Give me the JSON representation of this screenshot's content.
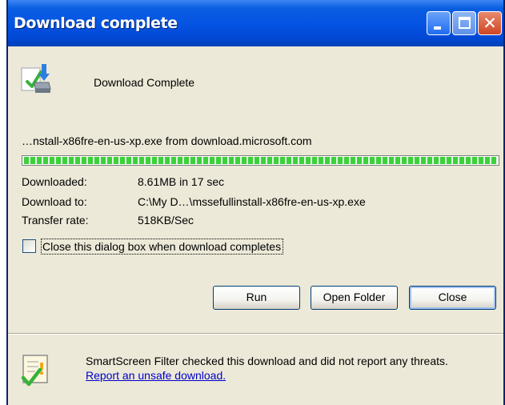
{
  "window": {
    "title": "Download complete"
  },
  "header": {
    "text": "Download Complete",
    "icon": "download-complete-icon"
  },
  "download": {
    "filename_line": "…nstall-x86fre-en-us-xp.exe from download.microsoft.com",
    "progress_percent": 100,
    "downloaded_label": "Downloaded:",
    "downloaded_value": "8.61MB in 17 sec",
    "download_to_label": "Download to:",
    "download_to_value": "C:\\My D…\\mssefullinstall-x86fre-en-us-xp.exe",
    "transfer_rate_label": "Transfer rate:",
    "transfer_rate_value": "518KB/Sec"
  },
  "options": {
    "close_checkbox_label": "Close this dialog box when download completes",
    "close_checkbox_checked": false
  },
  "buttons": {
    "run_label": "Run",
    "open_folder_label": "Open Folder",
    "close_label": "Close"
  },
  "smartscreen": {
    "message": "SmartScreen Filter checked this download and did not report any threats.",
    "link_text": "Report an unsafe download."
  },
  "colors": {
    "titlebar": "#0554e3",
    "progress": "#3cd13a",
    "link": "#0000cc",
    "dialog_bg": "#ece9d8"
  }
}
